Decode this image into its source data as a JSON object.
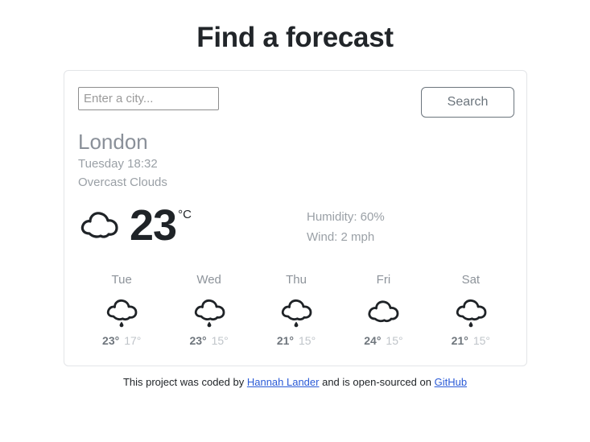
{
  "header": {
    "title": "Find a forecast"
  },
  "search": {
    "placeholder": "Enter a city...",
    "value": "",
    "button_label": "Search"
  },
  "current": {
    "city": "London",
    "datetime": "Tuesday 18:32",
    "description": "Overcast Clouds",
    "temperature": "23",
    "unit": "°C",
    "icon": "cloud-icon",
    "humidity_label": "Humidity: 60%",
    "wind_label": "Wind: 2 mph"
  },
  "forecast": [
    {
      "day": "Tue",
      "icon": "cloud-rain-icon",
      "max": "23°",
      "min": "17°"
    },
    {
      "day": "Wed",
      "icon": "cloud-rain-icon",
      "max": "23°",
      "min": "15°"
    },
    {
      "day": "Thu",
      "icon": "cloud-rain-icon",
      "max": "21°",
      "min": "15°"
    },
    {
      "day": "Fri",
      "icon": "cloud-icon",
      "max": "24°",
      "min": "15°"
    },
    {
      "day": "Sat",
      "icon": "cloud-rain-icon",
      "max": "21°",
      "min": "15°"
    }
  ],
  "footer": {
    "text_before": "This project was coded by ",
    "author_link": "Hannah Lander",
    "text_middle": " and is open-sourced on ",
    "source_link": "GitHub"
  },
  "colors": {
    "title": "#212529",
    "muted": "#9aa0a6",
    "accent_link": "#2b5bd7",
    "button_border": "#6c757d",
    "card_border": "#e3e5e8"
  }
}
